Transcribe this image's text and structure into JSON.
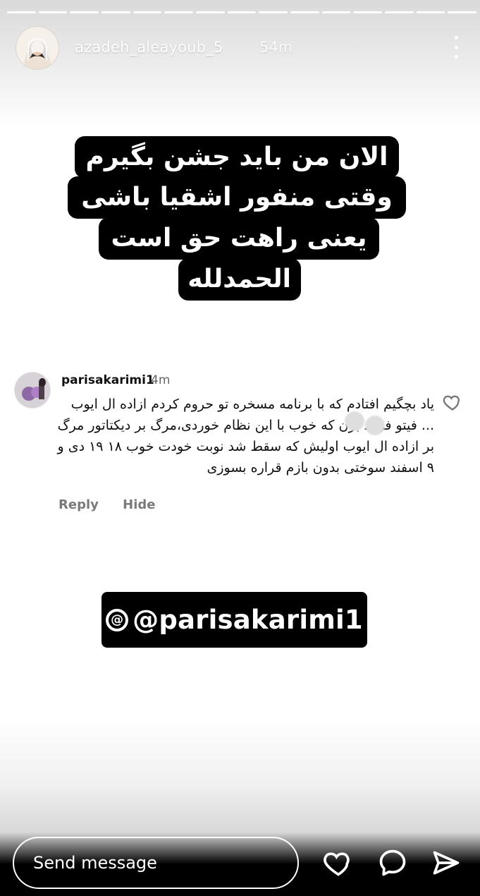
{
  "story": {
    "segments_count": 15,
    "username": "azadeh_aleayoub_5",
    "time": "54m",
    "text_lines": [
      "الان من باید جشن بگیرم",
      "وقتی منفور اشقیا باشی",
      "یعنی راهت حق است",
      "الحمدلله"
    ]
  },
  "comment": {
    "username": "parisakarimi1",
    "time": "4m",
    "body": "یاد بچگیم افتادم که با برنامه مسخره تو حروم کردم ازاده ال ایوب ... فیتو فریاد بزن که خوب با این نظام خوردی،مرگ بر دیکتاتور مرگ بر ازاده ال ایوب اولیش که سقط شد نوبت خودت خوب ۱۸ ۱۹ دی و ۹ اسفند سوختی بدون بازم قراره بسوزی",
    "reply_label": "Reply",
    "hide_label": "Hide"
  },
  "mention": {
    "handle": "@parisakarimi1"
  },
  "bottom": {
    "send_placeholder": "Send message"
  },
  "colors": {
    "background_top": "#d9d9d9",
    "background_middle": "#ffffff",
    "text_dark": "#111111",
    "muted": "#7a7a7a"
  },
  "icons": {
    "more": "more-vertical-icon",
    "comment_like": "heart-outline-icon",
    "like": "heart-icon",
    "reply": "chat-bubble-icon",
    "share": "send-icon",
    "threads": "threads-icon"
  }
}
